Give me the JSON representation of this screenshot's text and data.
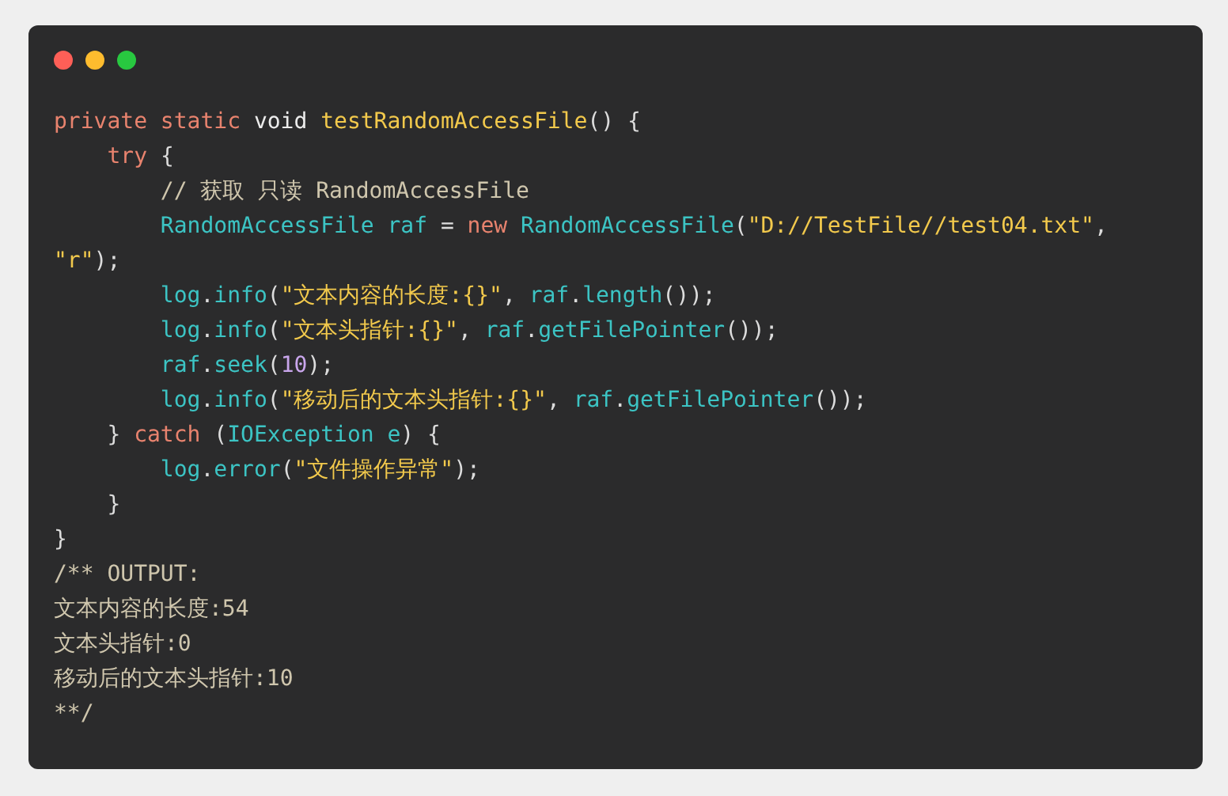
{
  "window": {
    "controls": [
      {
        "color": "#fe5f57"
      },
      {
        "color": "#febc2e"
      },
      {
        "color": "#28c840"
      }
    ]
  },
  "code": {
    "lines": [
      [
        {
          "text": "private static ",
          "kind": "keyword"
        },
        {
          "text": "void ",
          "kind": "type"
        },
        {
          "text": "testRandomAccessFile",
          "kind": "function"
        },
        {
          "text": "() {",
          "kind": "plain"
        }
      ],
      [
        {
          "text": "    try",
          "kind": "keyword"
        },
        {
          "text": " {",
          "kind": "plain"
        }
      ],
      [
        {
          "text": "        // 获取 只读 RandomAccessFile",
          "kind": "comment"
        }
      ],
      [
        {
          "text": "        RandomAccessFile raf ",
          "kind": "ident"
        },
        {
          "text": "= ",
          "kind": "plain"
        },
        {
          "text": "new ",
          "kind": "keyword"
        },
        {
          "text": "RandomAccessFile",
          "kind": "ident"
        },
        {
          "text": "(",
          "kind": "plain"
        },
        {
          "text": "\"D://TestFile//test04.txt\"",
          "kind": "string"
        },
        {
          "text": ",",
          "kind": "plain"
        }
      ],
      [
        {
          "text": "\"r\"",
          "kind": "string"
        },
        {
          "text": ");",
          "kind": "plain"
        }
      ],
      [
        {
          "text": "        log",
          "kind": "ident"
        },
        {
          "text": ".",
          "kind": "plain"
        },
        {
          "text": "info",
          "kind": "ident"
        },
        {
          "text": "(",
          "kind": "plain"
        },
        {
          "text": "\"文本内容的长度:{}\"",
          "kind": "string"
        },
        {
          "text": ", ",
          "kind": "plain"
        },
        {
          "text": "raf",
          "kind": "ident"
        },
        {
          "text": ".",
          "kind": "plain"
        },
        {
          "text": "length",
          "kind": "ident"
        },
        {
          "text": "());",
          "kind": "plain"
        }
      ],
      [
        {
          "text": "        log",
          "kind": "ident"
        },
        {
          "text": ".",
          "kind": "plain"
        },
        {
          "text": "info",
          "kind": "ident"
        },
        {
          "text": "(",
          "kind": "plain"
        },
        {
          "text": "\"文本头指针:{}\"",
          "kind": "string"
        },
        {
          "text": ", ",
          "kind": "plain"
        },
        {
          "text": "raf",
          "kind": "ident"
        },
        {
          "text": ".",
          "kind": "plain"
        },
        {
          "text": "getFilePointer",
          "kind": "ident"
        },
        {
          "text": "());",
          "kind": "plain"
        }
      ],
      [
        {
          "text": "        raf",
          "kind": "ident"
        },
        {
          "text": ".",
          "kind": "plain"
        },
        {
          "text": "seek",
          "kind": "ident"
        },
        {
          "text": "(",
          "kind": "plain"
        },
        {
          "text": "10",
          "kind": "number"
        },
        {
          "text": ");",
          "kind": "plain"
        }
      ],
      [
        {
          "text": "        log",
          "kind": "ident"
        },
        {
          "text": ".",
          "kind": "plain"
        },
        {
          "text": "info",
          "kind": "ident"
        },
        {
          "text": "(",
          "kind": "plain"
        },
        {
          "text": "\"移动后的文本头指针:{}\"",
          "kind": "string"
        },
        {
          "text": ", ",
          "kind": "plain"
        },
        {
          "text": "raf",
          "kind": "ident"
        },
        {
          "text": ".",
          "kind": "plain"
        },
        {
          "text": "getFilePointer",
          "kind": "ident"
        },
        {
          "text": "());",
          "kind": "plain"
        }
      ],
      [
        {
          "text": "    } ",
          "kind": "plain"
        },
        {
          "text": "catch ",
          "kind": "keyword"
        },
        {
          "text": "(",
          "kind": "plain"
        },
        {
          "text": "IOException e",
          "kind": "ident"
        },
        {
          "text": ") {",
          "kind": "plain"
        }
      ],
      [
        {
          "text": "        log",
          "kind": "ident"
        },
        {
          "text": ".",
          "kind": "plain"
        },
        {
          "text": "error",
          "kind": "ident"
        },
        {
          "text": "(",
          "kind": "plain"
        },
        {
          "text": "\"文件操作异常\"",
          "kind": "string"
        },
        {
          "text": ");",
          "kind": "plain"
        }
      ],
      [
        {
          "text": "    }",
          "kind": "plain"
        }
      ],
      [
        {
          "text": "}",
          "kind": "plain"
        }
      ],
      [
        {
          "text": "/** OUTPUT:",
          "kind": "comment"
        }
      ],
      [
        {
          "text": "文本内容的长度:54",
          "kind": "comment"
        }
      ],
      [
        {
          "text": "文本头指针:0",
          "kind": "comment"
        }
      ],
      [
        {
          "text": "移动后的文本头指针:10",
          "kind": "comment"
        }
      ],
      [
        {
          "text": "**/",
          "kind": "comment"
        }
      ]
    ]
  }
}
